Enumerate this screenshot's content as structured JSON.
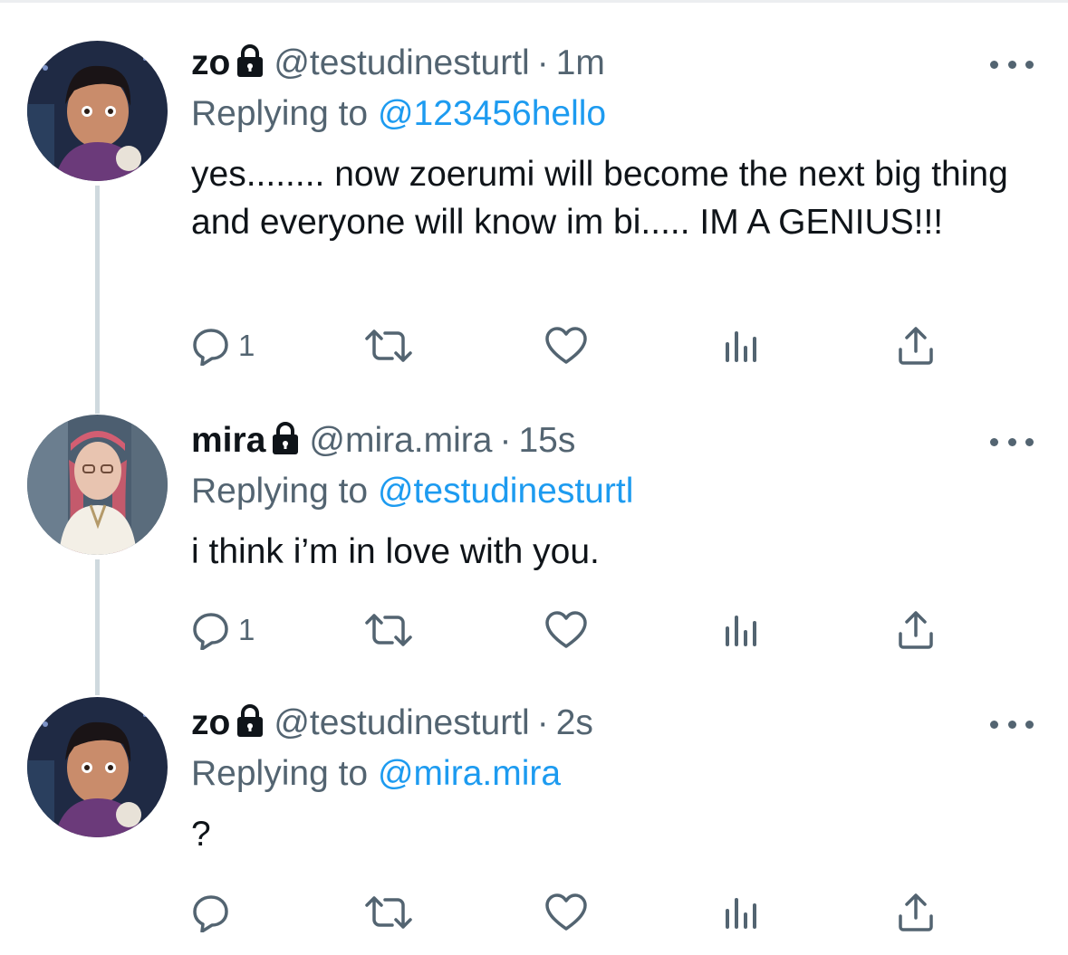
{
  "colors": {
    "accent": "#1d9bf0",
    "text_primary": "#0f1419",
    "text_secondary": "#536471",
    "thread_line": "#cfd9de"
  },
  "icons": {
    "more": "ellipsis-icon",
    "reply": "reply-icon",
    "retweet": "retweet-icon",
    "like": "heart-icon",
    "analytics": "analytics-icon",
    "share": "share-icon",
    "protected": "lock-icon"
  },
  "tweets": [
    {
      "name": "zo",
      "handle": "@testudinesturtl",
      "separator": "·",
      "time": "1m",
      "replying_prefix": "Replying to",
      "replying_to": "@123456hello",
      "text": "yes........ now zoerumi will become the next big thing and everyone will know im bi..... IM A GENIUS!!!",
      "reply_count": "1"
    },
    {
      "name": "mira",
      "handle": "@mira.mira",
      "separator": "·",
      "time": "15s",
      "replying_prefix": "Replying to",
      "replying_to": "@testudinesturtl",
      "text": "i think i’m in love with you.",
      "reply_count": "1"
    },
    {
      "name": "zo",
      "handle": "@testudinesturtl",
      "separator": "·",
      "time": "2s",
      "replying_prefix": "Replying to",
      "replying_to": "@mira.mira",
      "text": "?",
      "reply_count": ""
    }
  ]
}
